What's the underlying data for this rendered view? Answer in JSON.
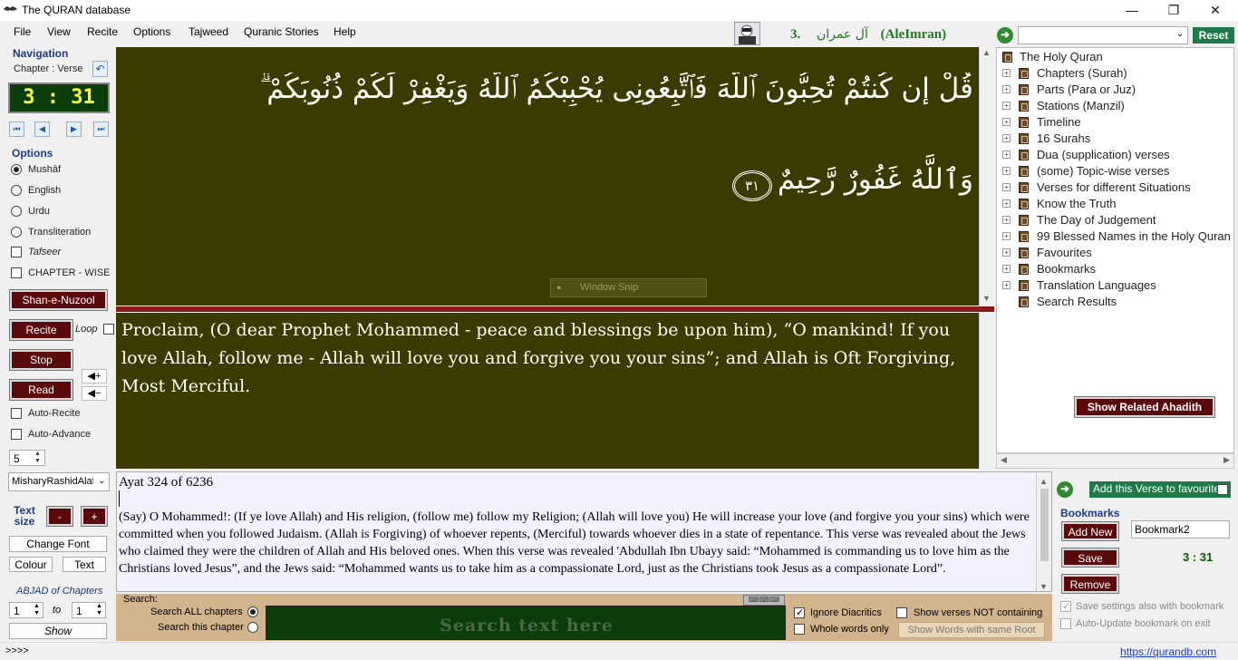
{
  "window": {
    "title": "The QURAN database",
    "minimize": "—",
    "restore": "❐",
    "close": "✕"
  },
  "menu": [
    "File",
    "View",
    "Recite",
    "Options",
    "Tajweed",
    "Quranic Stories",
    "Help"
  ],
  "header": {
    "surah_number": "3.",
    "surah_arabic": "آل عمران",
    "surah_latin": "(AleImran)"
  },
  "nav": {
    "title": "Navigation",
    "mode": "Chapter : Verse",
    "position": "3 : 31",
    "buttons": {
      "first": "⏮",
      "prev": "◀",
      "next": "▶",
      "last": "⏭"
    }
  },
  "options": {
    "title": "Options",
    "items": [
      {
        "label": "Mushāf",
        "selected": true
      },
      {
        "label": "English",
        "selected": false
      },
      {
        "label": "Urdu",
        "selected": false
      },
      {
        "label": "Transliteration",
        "selected": false
      }
    ],
    "tafseer": "Tafseer",
    "chapter_wise": "CHAPTER - WISE",
    "shan_e_nuzool": "Shan-e-Nuzool"
  },
  "recite": {
    "recite": "Recite",
    "loop": "Loop",
    "stop": "Stop",
    "read": "Read",
    "auto_recite": "Auto-Recite",
    "auto_advance": "Auto-Advance",
    "spinner_value": "5",
    "reciter": "MisharyRashidAlafa"
  },
  "text_size": {
    "label": "Text size",
    "minus": "-",
    "plus": "+",
    "change_font": "Change Font",
    "colour": "Colour",
    "text": "Text"
  },
  "abjad": {
    "label": "ABJAD of Chapters",
    "from": "1",
    "to_label": "to",
    "to": "1",
    "show": "Show"
  },
  "arabic": {
    "line1": "قُلْ إِن كُنتُمْ تُحِبُّونَ ٱللَّهَ فَٱتَّبِعُونِى يُحْبِبْكُمُ ٱللَّهُ وَيَغْفِرْ لَكُمْ ذُنُوبَكُمْ ۗ",
    "line2": "وَٱللَّهُ غَفُورٌ رَّحِيمٌ",
    "verse_marker": "٣١",
    "snip_overlay": "Window Snip"
  },
  "translation": "Proclaim, (O dear Prophet Mohammed - peace and blessings be upon him), “O mankind! If you love Allah, follow me - Allah will love you and forgive you your sins”; and Allah is Oft Forgiving, Most Merciful.",
  "tree": {
    "search_value": "",
    "reset": "Reset",
    "root": "The Holy Quran",
    "items": [
      "Chapters (Surah)",
      "Parts (Para or Juz)",
      "Stations (Manzil)",
      "Timeline",
      "16 Surahs",
      "Dua (supplication) verses",
      "(some) Topic-wise verses",
      "Verses for different Situations",
      "Know the Truth",
      "The Day of Judgement",
      "99 Blessed Names in the Holy Quran",
      "Favourites",
      "Bookmarks",
      "Translation Languages",
      "Search Results"
    ],
    "show_ahadith": "Show Related Ahadith"
  },
  "notes": {
    "ayat_label": "Ayat  324  of  6236",
    "tafseer": "(Say) O Mohammed!: (If ye love Allah) and His religion, (follow me) follow my Religion; (Allah will love you) He will increase your love (and forgive you your sins) which were committed when you followed Judaism. (Allah is Forgiving) of whoever repents, (Merciful) towards whoever dies in a state of repentance. This verse was revealed about the Jews who claimed they were the children of Allah and His beloved ones. When this verse was revealed 'Abdullah Ibn Ubayy said: “Mohammed is commanding us to love him as the Christians loved Jesus”, and the Jews said: “Mohammed wants us to take him as a compassionate Lord, just as the Christians took Jesus as a compassionate Lord”."
  },
  "bookmarks": {
    "add_fav": "Add this Verse to favourites",
    "title": "Bookmarks",
    "add_new": "Add New",
    "name": "Bookmark2",
    "save": "Save",
    "remove": "Remove",
    "position": "3 : 31",
    "save_settings": "Save settings also with bookmark",
    "auto_update": "Auto-Update bookmark on exit"
  },
  "search": {
    "label": "Search:",
    "all_chapters": "Search ALL chapters",
    "this_chapter": "Search this chapter",
    "placeholder": "Search text here",
    "ignore_diacritics": "Ignore Diacritics",
    "whole_words": "Whole words only",
    "show_not_containing": "Show verses NOT containing",
    "same_root": "Show Words with same Root"
  },
  "status": {
    "left": ">>>>",
    "link": "https://qurandb.com"
  },
  "colors": {
    "panel_bg": "#3b3b00",
    "dark_button": "#5a0a0a",
    "lcd_bg": "#0b3d0b",
    "lcd_text": "#ffff30"
  }
}
